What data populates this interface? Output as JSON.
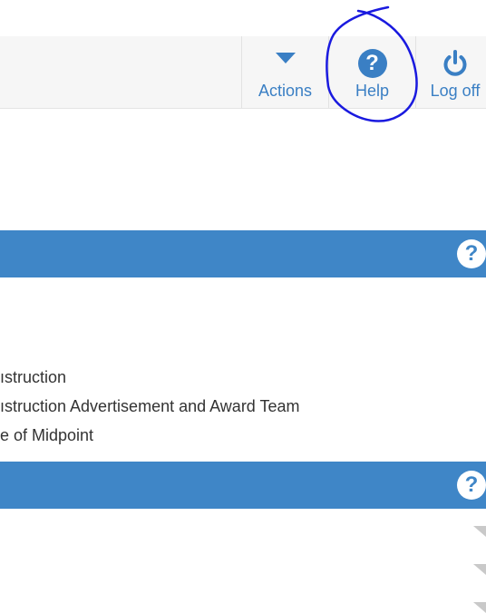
{
  "toolbar": {
    "actions": {
      "label": "Actions",
      "icon": "caret-down-icon"
    },
    "help": {
      "label": "Help",
      "icon": "question-circle-icon",
      "symbol": "?"
    },
    "logoff": {
      "label": "Log off",
      "icon": "power-icon"
    }
  },
  "panel1": {
    "help_symbol": "?"
  },
  "text_lines": [
    "ıstruction",
    "ıstruction Advertisement and Award Team",
    "e of Midpoint"
  ],
  "panel2": {
    "help_symbol": "?"
  },
  "colors": {
    "accent": "#3a7fc4",
    "panel_bar": "#3f86c7",
    "annotation_ink": "#1a1adf",
    "toolbar_bg": "#f6f6f6"
  }
}
